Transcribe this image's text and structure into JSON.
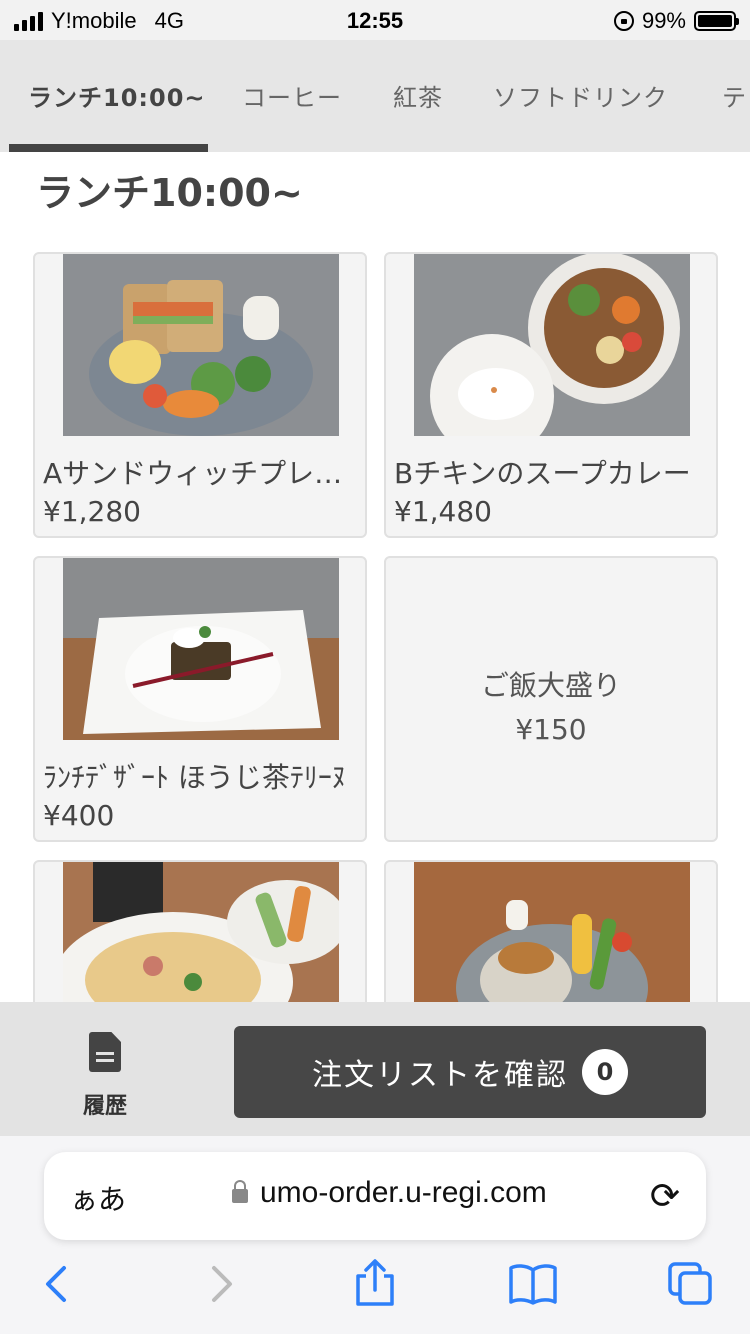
{
  "status_bar": {
    "carrier": "Y!mobile",
    "network": "4G",
    "time": "12:55",
    "battery": "99%",
    "battery_level": 0.99
  },
  "tabs": [
    {
      "label": "ランチ10:00~",
      "active": true
    },
    {
      "label": "コーヒー",
      "active": false
    },
    {
      "label": "紅茶",
      "active": false
    },
    {
      "label": "ソフトドリンク",
      "active": false
    },
    {
      "label": "テ",
      "active": false
    }
  ],
  "section_title": "ランチ10:00~",
  "menu_items": [
    {
      "name": "Aサンドウィッチプレート",
      "price": "¥1,280",
      "image": "sandwich-plate-photo"
    },
    {
      "name": "Bチキンのスープカレー",
      "price": "¥1,480",
      "image": "soup-curry-photo"
    },
    {
      "name": "ﾗﾝﾁﾃﾞｻﾞｰﾄ ほうじ茶ﾃﾘｰﾇ",
      "price": "¥400",
      "image": "dessert-photo"
    },
    {
      "name": "ご飯大盛り",
      "price": "¥150",
      "image": ""
    },
    {
      "name": "",
      "price": "",
      "image": "pasta-photo"
    },
    {
      "name": "",
      "price": "",
      "image": "rice-plate-photo"
    }
  ],
  "action_bar": {
    "history_label": "履歴",
    "history_icon": "document-icon",
    "order_button_label": "注文リストを確認",
    "order_count": "0"
  },
  "browser": {
    "aa_label": "ぁあ",
    "url": "umo-order.u-regi.com",
    "icons": [
      "lock-icon",
      "reload-icon",
      "back-icon",
      "forward-icon",
      "share-icon",
      "bookmarks-icon",
      "tabs-icon"
    ]
  },
  "colors": {
    "tab_bar_bg": "#e6e6e6",
    "card_bg": "#f4f4f4",
    "button_bg": "#474747",
    "safari_blue": "#2d7ff9"
  }
}
